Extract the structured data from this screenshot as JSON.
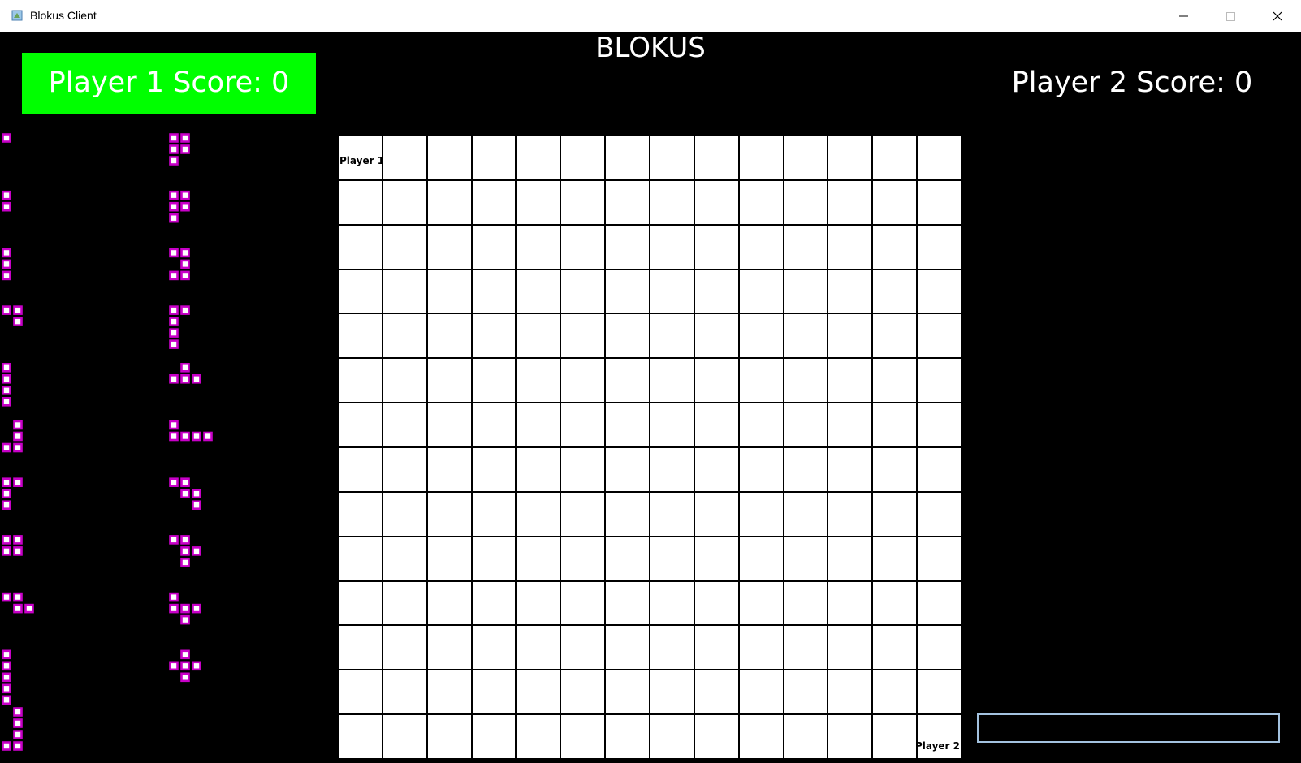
{
  "window": {
    "title": "Blokus Client"
  },
  "game": {
    "title": "BLOKUS",
    "player1_score_label": "Player 1 Score: 0",
    "player2_score_label": "Player 2 Score: 0",
    "board": {
      "rows": 14,
      "cols": 14,
      "start_label_p1": "Player 1",
      "start_label_p2": "Player 2"
    },
    "piece_color": "#c800c8",
    "highlight_color": "#00ff00",
    "pieces": [
      [
        [
          0,
          0
        ]
      ],
      [
        [
          0,
          0
        ],
        [
          0,
          1
        ]
      ],
      [
        [
          0,
          0
        ],
        [
          0,
          1
        ],
        [
          0,
          2
        ]
      ],
      [
        [
          0,
          0
        ],
        [
          1,
          0
        ],
        [
          1,
          1
        ]
      ],
      [
        [
          0,
          0
        ],
        [
          0,
          1
        ],
        [
          0,
          2
        ],
        [
          0,
          3
        ]
      ],
      [
        [
          1,
          0
        ],
        [
          1,
          1
        ],
        [
          0,
          2
        ],
        [
          1,
          2
        ]
      ],
      [
        [
          0,
          0
        ],
        [
          1,
          0
        ],
        [
          0,
          1
        ],
        [
          0,
          2
        ]
      ],
      [
        [
          0,
          0
        ],
        [
          1,
          0
        ],
        [
          0,
          1
        ],
        [
          1,
          1
        ]
      ],
      [
        [
          0,
          0
        ],
        [
          1,
          0
        ],
        [
          1,
          1
        ],
        [
          2,
          1
        ]
      ],
      [
        [
          0,
          0
        ],
        [
          0,
          1
        ],
        [
          0,
          2
        ],
        [
          0,
          3
        ],
        [
          0,
          4
        ]
      ],
      [
        [
          1,
          0
        ],
        [
          1,
          1
        ],
        [
          1,
          2
        ],
        [
          0,
          3
        ],
        [
          1,
          3
        ]
      ],
      [
        [
          0,
          0
        ],
        [
          1,
          0
        ],
        [
          0,
          1
        ],
        [
          1,
          1
        ],
        [
          0,
          2
        ]
      ],
      [
        [
          0,
          0
        ],
        [
          1,
          0
        ],
        [
          0,
          1
        ],
        [
          1,
          1
        ],
        [
          0,
          2
        ]
      ],
      [
        [
          0,
          0
        ],
        [
          1,
          0
        ],
        [
          1,
          1
        ],
        [
          0,
          2
        ],
        [
          1,
          2
        ]
      ],
      [
        [
          0,
          0
        ],
        [
          1,
          0
        ],
        [
          0,
          1
        ],
        [
          0,
          2
        ],
        [
          0,
          3
        ]
      ],
      [
        [
          1,
          0
        ],
        [
          0,
          1
        ],
        [
          1,
          1
        ],
        [
          2,
          1
        ]
      ],
      [
        [
          0,
          0
        ],
        [
          0,
          1
        ],
        [
          1,
          1
        ],
        [
          2,
          1
        ],
        [
          3,
          1
        ]
      ],
      [
        [
          0,
          0
        ],
        [
          1,
          0
        ],
        [
          1,
          1
        ],
        [
          2,
          1
        ],
        [
          2,
          2
        ]
      ],
      [
        [
          0,
          0
        ],
        [
          1,
          0
        ],
        [
          1,
          1
        ],
        [
          2,
          1
        ],
        [
          1,
          2
        ]
      ],
      [
        [
          0,
          0
        ],
        [
          0,
          1
        ],
        [
          1,
          1
        ],
        [
          2,
          1
        ],
        [
          1,
          2
        ]
      ],
      [
        [
          1,
          0
        ],
        [
          0,
          1
        ],
        [
          1,
          1
        ],
        [
          2,
          1
        ],
        [
          1,
          2
        ]
      ]
    ]
  },
  "chat": {
    "value": ""
  }
}
